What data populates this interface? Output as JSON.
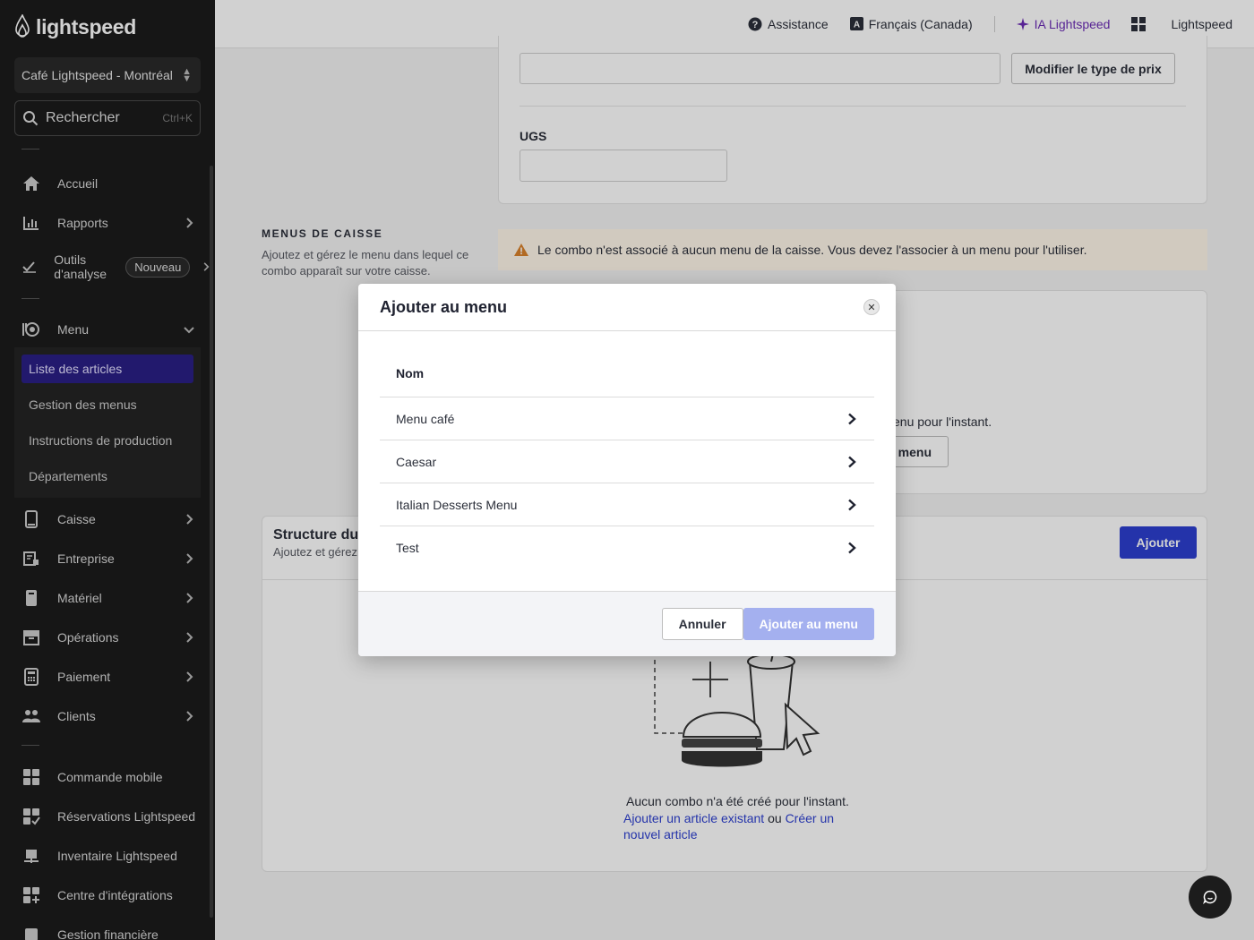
{
  "brand": {
    "logo_text": "lightspeed"
  },
  "sidebar": {
    "store": "Café Lightspeed - Montréal",
    "search_placeholder": "Rechercher",
    "search_shortcut": "Ctrl+K",
    "items": [
      {
        "label": "Accueil",
        "icon": "home-icon"
      },
      {
        "label": "Rapports",
        "icon": "chart-icon"
      },
      {
        "label": "Outils d'analyse",
        "badge": "Nouveau",
        "icon": "analytics-icon"
      },
      {
        "label": "Menu",
        "icon": "menu-icon"
      },
      {
        "label": "Caisse",
        "icon": "register-icon"
      },
      {
        "label": "Entreprise",
        "icon": "business-icon"
      },
      {
        "label": "Matériel",
        "icon": "hardware-icon"
      },
      {
        "label": "Opérations",
        "icon": "operations-icon"
      },
      {
        "label": "Paiement",
        "icon": "payment-icon"
      },
      {
        "label": "Clients",
        "icon": "clients-icon"
      },
      {
        "label": "Commande mobile",
        "icon": "mobile-order-icon"
      },
      {
        "label": "Réservations Lightspeed",
        "icon": "reservations-icon"
      },
      {
        "label": "Inventaire Lightspeed",
        "icon": "inventory-icon"
      },
      {
        "label": "Centre d'intégrations",
        "icon": "integrations-icon"
      },
      {
        "label": "Gestion financière",
        "icon": "finance-icon"
      }
    ],
    "submenu": [
      "Liste des articles",
      "Gestion des menus",
      "Instructions de production",
      "Départements"
    ]
  },
  "topbar": {
    "help": "Assistance",
    "language": "Français (Canada)",
    "ai": "IA Lightspeed",
    "account": "Lightspeed"
  },
  "main": {
    "price_type_button": "Modifier le type de prix",
    "sku_label": "UGS",
    "pos_menus_title": "MENUS DE CAISSE",
    "pos_menus_desc": "Ajoutez et gérez le menu dans lequel ce combo apparaît sur votre caisse.",
    "warning": "Le combo n'est associé à aucun menu de la caisse. Vous devez l'associer à un menu pour l'utiliser.",
    "no_menu_partial": "enu pour l'instant.",
    "add_menu_partial": "menu",
    "structure_title_partial": "Structure du c",
    "structure_desc_partial": "Ajoutez et gérez",
    "add_button": "Ajouter",
    "empty_text": "Aucun combo n'a été créé pour l'instant.",
    "empty_link1": "Ajouter un article existant",
    "empty_or": " ou ",
    "empty_link2": "Créer un nouvel article"
  },
  "modal": {
    "title": "Ajouter au menu",
    "column_header": "Nom",
    "rows": [
      "Menu café",
      "Caesar",
      "Italian Desserts Menu",
      "Test"
    ],
    "cancel": "Annuler",
    "confirm": "Ajouter au menu"
  },
  "colors": {
    "accent": "#2a1f86",
    "primary_disabled": "#a4b0ef",
    "link": "#2c3fd0",
    "ai": "#6b2bb5"
  }
}
